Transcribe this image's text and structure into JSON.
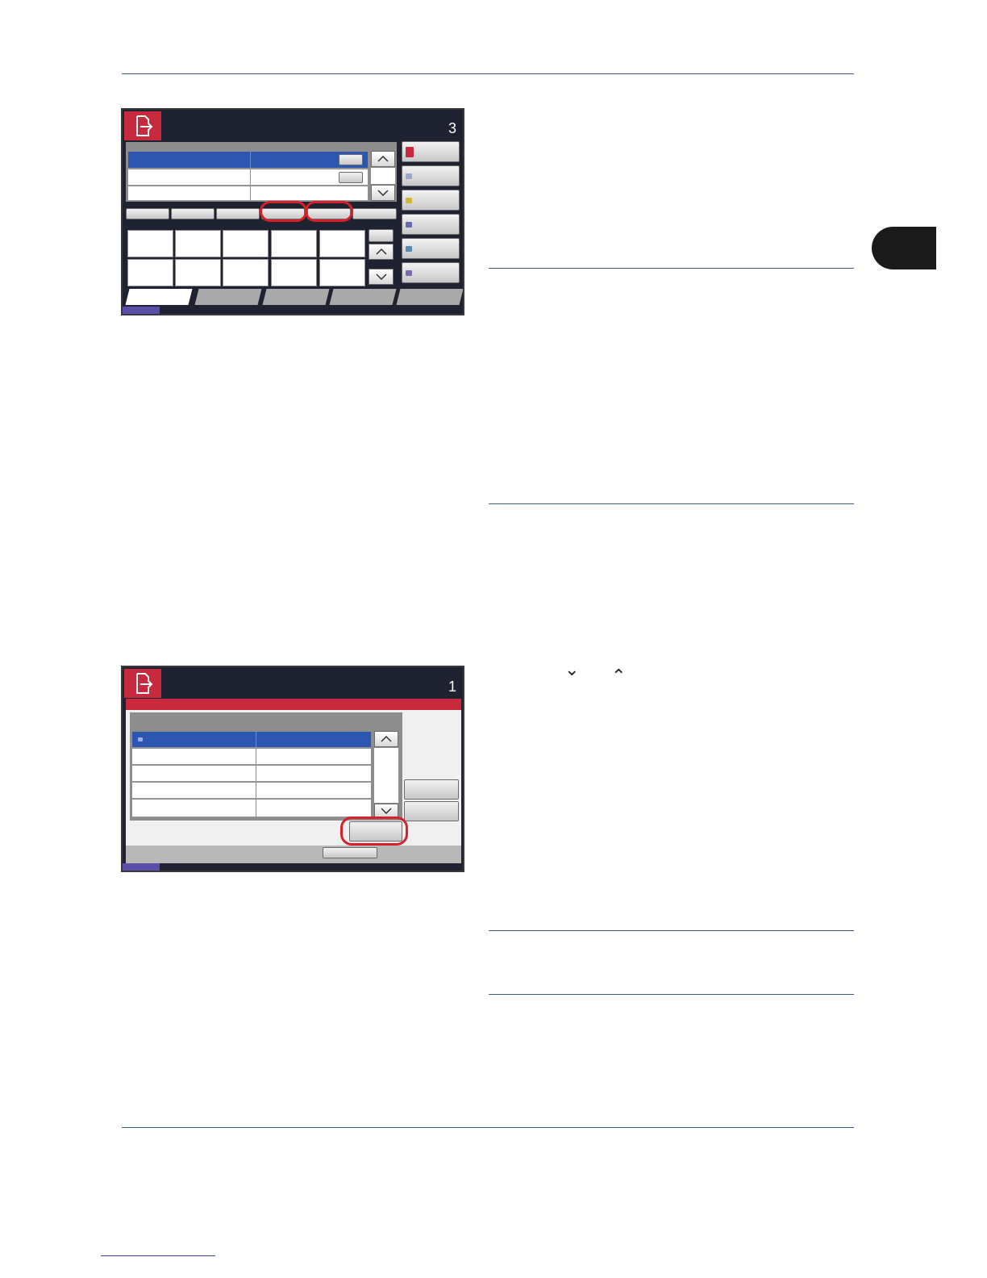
{
  "panel1": {
    "count": "3"
  },
  "panel2": {
    "count": "1"
  },
  "text": {
    "arrow_down": "⌄",
    "arrow_up": "⌃"
  },
  "colors": {
    "accent": "#c62a3c",
    "selection": "#2d56b0",
    "highlight": "#d8202a",
    "rule": "#3b5a8a"
  }
}
